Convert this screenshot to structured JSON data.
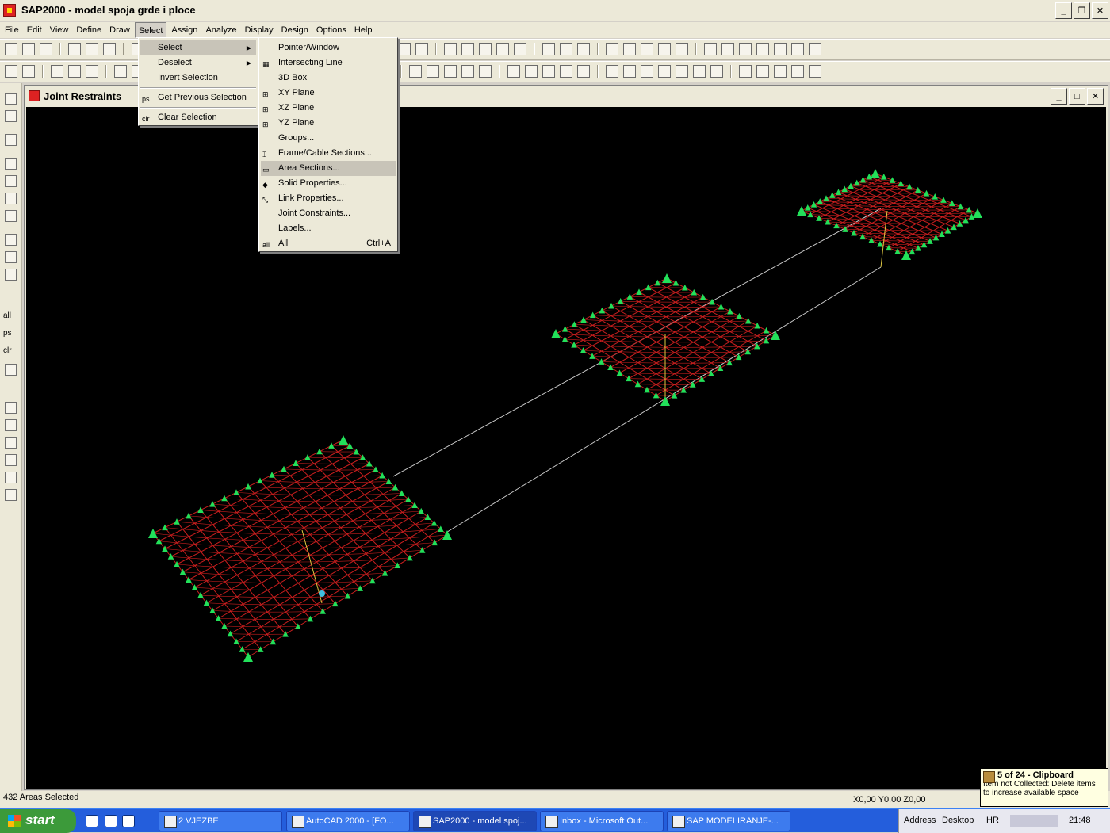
{
  "window": {
    "title": "SAP2000 - model spoja grde i ploce"
  },
  "menubar": [
    "File",
    "Edit",
    "View",
    "Define",
    "Draw",
    "Select",
    "Assign",
    "Analyze",
    "Display",
    "Design",
    "Options",
    "Help"
  ],
  "select_menu": {
    "items": [
      {
        "label": "Select",
        "submenu": true,
        "icon": ""
      },
      {
        "label": "Deselect",
        "submenu": true,
        "icon": ""
      },
      {
        "label": "Invert Selection",
        "icon": ""
      },
      {
        "label": "Get Previous Selection",
        "icon": "ps"
      },
      {
        "label": "Clear Selection",
        "icon": "clr"
      }
    ]
  },
  "select_submenu": {
    "items": [
      {
        "label": "Pointer/Window",
        "shortcut": ""
      },
      {
        "label": "Intersecting Line",
        "shortcut": ""
      },
      {
        "label": "3D Box",
        "shortcut": ""
      },
      {
        "label": "XY Plane",
        "shortcut": ""
      },
      {
        "label": "XZ Plane",
        "shortcut": ""
      },
      {
        "label": "YZ Plane",
        "shortcut": ""
      },
      {
        "label": "Groups...",
        "shortcut": ""
      },
      {
        "label": "Frame/Cable Sections...",
        "shortcut": ""
      },
      {
        "label": "Area Sections...",
        "shortcut": ""
      },
      {
        "label": "Solid Properties...",
        "shortcut": ""
      },
      {
        "label": "Link Properties...",
        "shortcut": ""
      },
      {
        "label": "Joint Constraints...",
        "shortcut": ""
      },
      {
        "label": "Labels...",
        "shortcut": ""
      },
      {
        "label": "All",
        "shortcut": "Ctrl+A",
        "icon": "all"
      }
    ]
  },
  "child_window": {
    "title": "Joint Restraints"
  },
  "left_toolbar": {
    "labels": [
      "all",
      "ps",
      "clr"
    ]
  },
  "status": {
    "left": "432 Areas Selected",
    "coords": "X0,00  Y0,00  Z0,00"
  },
  "clipboard_tip": {
    "title": "5 of 24 - Clipboard",
    "line1": "Item not Collected: Delete items",
    "line2": "to increase available space"
  },
  "taskbar": {
    "start": "start",
    "tasks": [
      "2 VJEZBE",
      "AutoCAD 2000 - [FO...",
      "SAP2000 - model spoj...",
      "Inbox - Microsoft Out...",
      "SAP  MODELIRANJE-..."
    ],
    "address": "Address",
    "desktop": "Desktop",
    "lang": "HR",
    "clock": "21:48"
  },
  "colors": {
    "mesh": "#c81e1e",
    "restraint": "#22e05a",
    "frame": "#c8c8c8",
    "axis": "#e0c840"
  }
}
